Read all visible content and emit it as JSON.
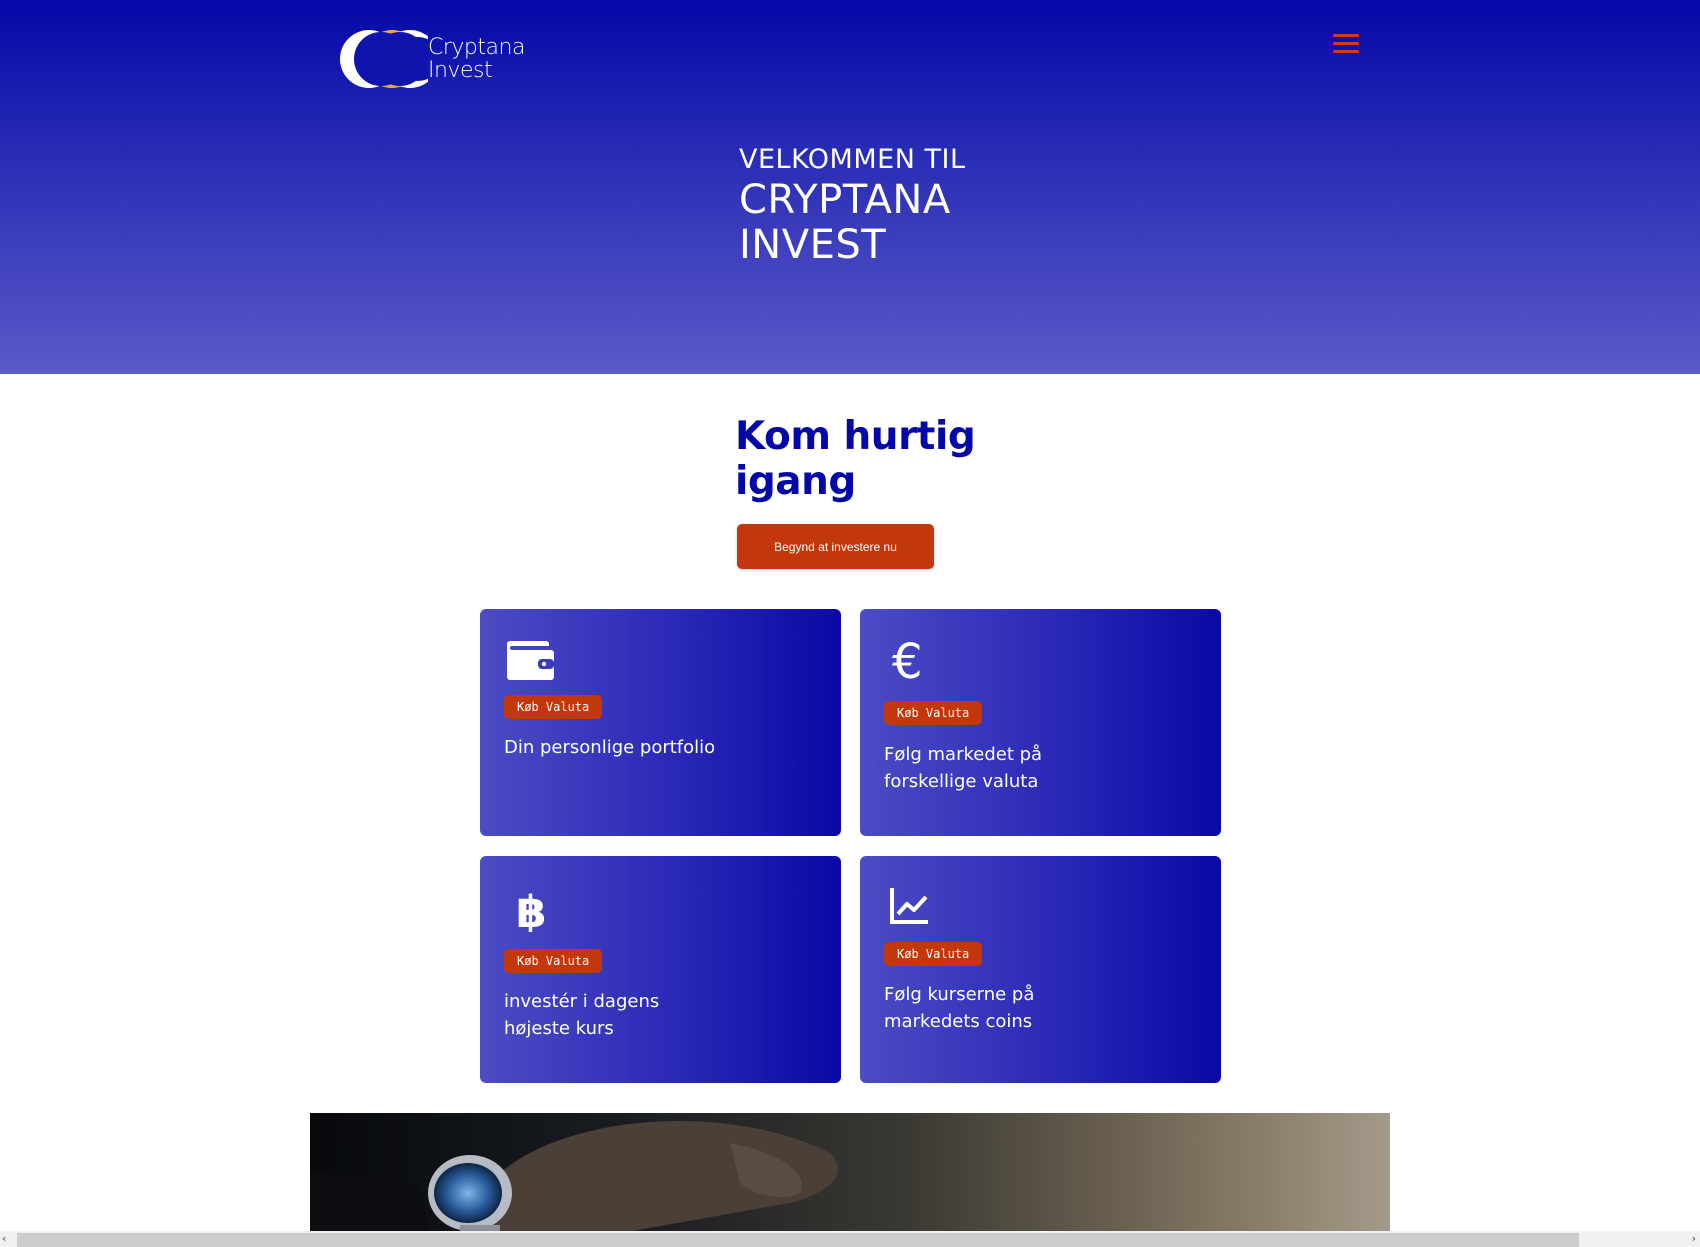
{
  "header": {
    "logo_line1": "Cryptana",
    "logo_line2": "Invest",
    "menu_icon": "hamburger-menu-icon"
  },
  "hero": {
    "line1": "VELKOMMEN TIL",
    "line2": "CRYPTANA",
    "line3": "INVEST"
  },
  "cta": {
    "heading_line1": "Kom hurtig",
    "heading_line2": "igang",
    "button_label": "Begynd at investere nu"
  },
  "cards": [
    {
      "icon": "wallet-icon",
      "badge": "Køb Valuta",
      "text": "Din personlige portfolio"
    },
    {
      "icon": "euro-icon",
      "badge": "Køb Valuta",
      "text_line1": "Følg markedet på",
      "text_line2": "forskellige valuta"
    },
    {
      "icon": "bitcoin-icon",
      "badge": "Køb Valuta",
      "text_line1": "investér i dagens",
      "text_line2": "højeste kurs"
    },
    {
      "icon": "line-chart-icon",
      "badge": "Køb Valuta",
      "text_line1": "Følg kurserne på",
      "text_line2": "markedets coins"
    }
  ],
  "colors": {
    "brand_blue": "#0408a8",
    "accent_orange": "#c2380c"
  }
}
